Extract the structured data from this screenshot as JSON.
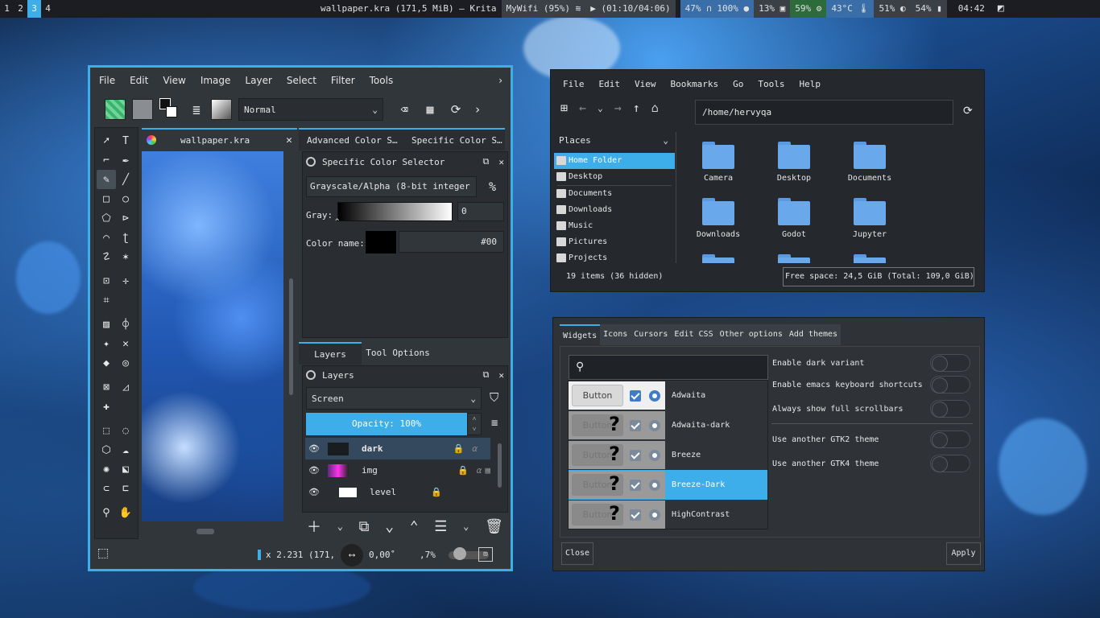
{
  "topbar": {
    "workspaces": [
      "1",
      "2",
      "3",
      "4"
    ],
    "active_workspace": "3",
    "window_title": "wallpaper.kra (171,5 MiB)  — Krita",
    "wifi": "MyWifi (95%)",
    "media": "(01:10/04:06)",
    "volume": "47%",
    "mic": "100%",
    "cpu": "13%",
    "mem": "59%",
    "temp": "43°C",
    "brightness": "51%",
    "battery": "54%",
    "clock": "04:42"
  },
  "krita": {
    "menu": [
      "File",
      "Edit",
      "View",
      "Image",
      "Layer",
      "Select",
      "Filter",
      "Tools"
    ],
    "blend_mode": "Normal",
    "doc_tab": "wallpaper.kra",
    "dock_tabs": [
      "Advanced Color S…",
      "Specific Color S…"
    ],
    "specific_color": {
      "title": "Specific Color Selector",
      "model": "Grayscale/Alpha (8-bit integer",
      "gray_label": "Gray:",
      "gray_value": "0",
      "color_name_label": "Color name:",
      "color_name_value": "#00"
    },
    "layers_tabs": [
      "Layers",
      "Tool Options"
    ],
    "layers": {
      "title": "Layers",
      "blend": "Screen",
      "opacity": "Opacity:  100%",
      "items": [
        "dark",
        "img",
        "level"
      ]
    },
    "status": {
      "size": "x 2.231 (171,",
      "angle": "0,00˚",
      "zoom": ",7%"
    }
  },
  "dolphin": {
    "menu": [
      "File",
      "Edit",
      "View",
      "Bookmarks",
      "Go",
      "Tools",
      "Help"
    ],
    "path": "/home/hervyqa",
    "places_label": "Places",
    "places": [
      "Home Folder",
      "Desktop",
      "Documents",
      "Downloads",
      "Music",
      "Pictures",
      "Projects"
    ],
    "folders": [
      "Camera",
      "Desktop",
      "Documents",
      "Downloads",
      "Godot",
      "Jupyter"
    ],
    "status_items": "19 items (36 hidden)",
    "free_space": "Free space: 24,5 GiB (Total: 109,0 GiB)"
  },
  "gtk": {
    "tabs": [
      "Widgets",
      "Icons",
      "Cursors",
      "Edit CSS",
      "Other options",
      "Add themes"
    ],
    "themes": [
      "Adwaita",
      "Adwaita-dark",
      "Breeze",
      "Breeze-Dark",
      "HighContrast"
    ],
    "selected_theme": "Breeze-Dark",
    "preview_button": "Button",
    "options": [
      "Enable dark variant",
      "Enable emacs keyboard shortcuts",
      "Always show full scrollbars",
      "Use another GTK2 theme",
      "Use another GTK4 theme"
    ],
    "close": "Close",
    "apply": "Apply"
  }
}
